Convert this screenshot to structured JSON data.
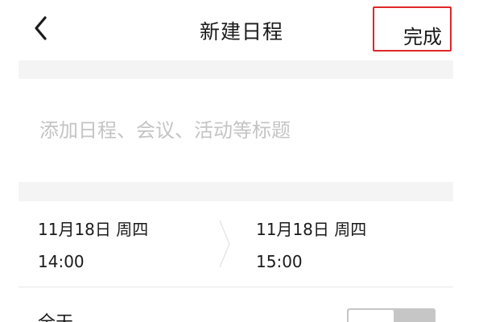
{
  "header": {
    "title": "新建日程",
    "done_label": "完成"
  },
  "event": {
    "title_placeholder": "添加日程、会议、活动等标题",
    "start": {
      "date": "11月18日 周四",
      "time": "14:00"
    },
    "end": {
      "date": "11月18日 周四",
      "time": "15:00"
    },
    "all_day_label": "全天",
    "all_day_enabled": false
  },
  "icons": {
    "back": "chevron-left-icon",
    "arrow": "chevron-right-icon"
  },
  "colors": {
    "highlight_border": "#e0262a",
    "placeholder": "#c4c4c4",
    "section_band": "#f4f4f4",
    "toggle_off": "#c6c6c6"
  }
}
